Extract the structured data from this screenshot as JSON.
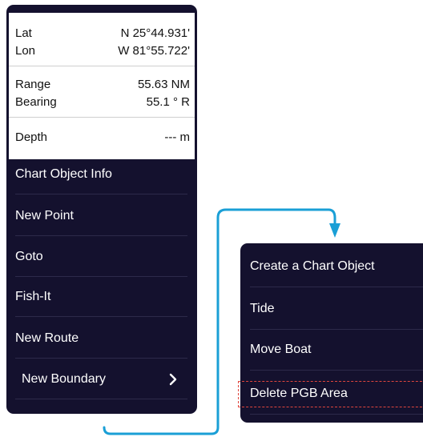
{
  "info": {
    "lat_label": "Lat",
    "lat_value": "N 25°44.931'",
    "lon_label": "Lon",
    "lon_value": "W 81°55.722'",
    "range_label": "Range",
    "range_value": "55.63 NM",
    "bearing_label": "Bearing",
    "bearing_value": "55.1 ° R",
    "depth_label": "Depth",
    "depth_value": "--- m"
  },
  "menu": {
    "items": [
      {
        "label": "Chart Object Info"
      },
      {
        "label": "New Point"
      },
      {
        "label": "Goto"
      },
      {
        "label": "Fish-It"
      },
      {
        "label": "New Route"
      },
      {
        "label": "New Boundary"
      }
    ],
    "submenu_icon": "chevron-right-icon"
  },
  "submenu": {
    "items": [
      {
        "label": "Create a Chart Object"
      },
      {
        "label": "Tide"
      },
      {
        "label": "Move Boat"
      },
      {
        "label": "Delete PGB Area"
      }
    ]
  },
  "colors": {
    "panel": "#14112e",
    "connector": "#1a9fd6",
    "highlight": "#e0463e"
  }
}
